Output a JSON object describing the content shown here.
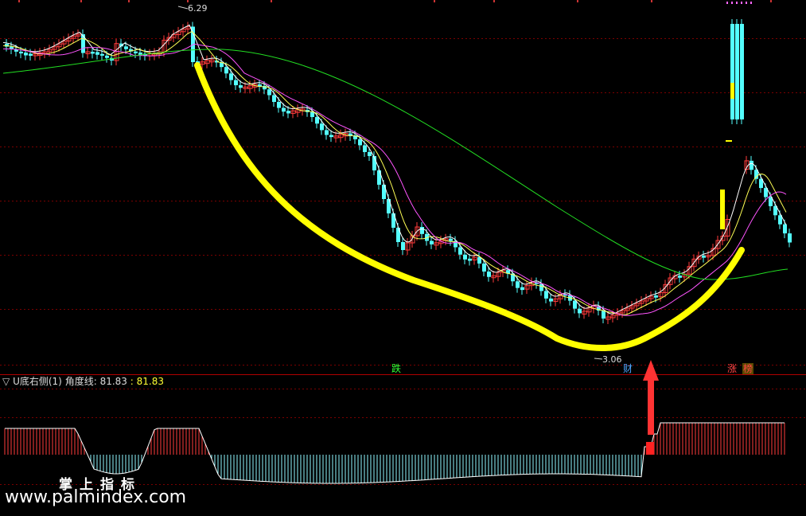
{
  "price_panel": {
    "high_label": "6.29",
    "low_label": "3.06",
    "markers": [
      "跌",
      "财",
      "涨",
      "榜"
    ]
  },
  "indicator_panel": {
    "prefix": "▽",
    "name": "U底右侧(1)",
    "line_label": "角度线:",
    "value1": "81.83",
    "value2": ": 81.83"
  },
  "watermark": {
    "line1": "掌上指标",
    "line2": "www.palmindex.com"
  },
  "colors": {
    "up": "#ff3b3b",
    "down": "#54ffff",
    "ma_fast": "#ffffff",
    "ma_mid": "#ffff55",
    "ma_slow": "#ff55ff",
    "ma_long": "#22dd22",
    "u_curve": "#ffff00",
    "arrow": "#ff3333",
    "grid": "#7a0000"
  },
  "chart_data": {
    "type": "candlestick-with-indicator",
    "price_range": [
      3.06,
      6.29
    ],
    "u_bottom_angle": 81.83,
    "indicator_note": "bars: red above zero, cyan below zero"
  }
}
